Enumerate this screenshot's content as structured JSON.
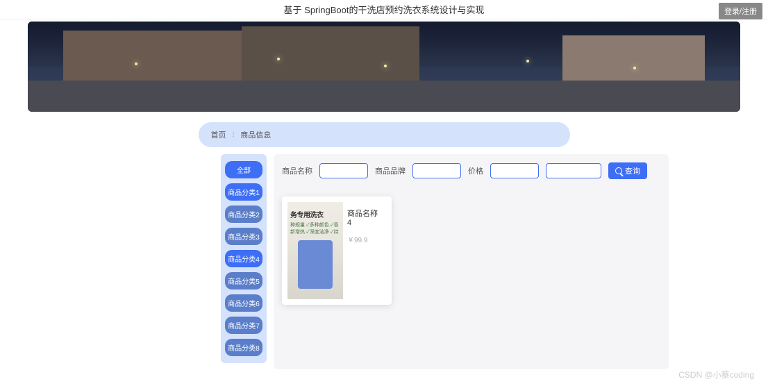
{
  "header": {
    "title": "基于 SpringBoot的干洗店预约洗衣系统设计与实现",
    "login_btn": "登录/注册"
  },
  "breadcrumb": {
    "home": "首页",
    "current": "商品信息"
  },
  "sidebar": {
    "categories": [
      {
        "label": "全部",
        "active": true
      },
      {
        "label": "商品分类1",
        "active": true
      },
      {
        "label": "商品分类2",
        "active": false
      },
      {
        "label": "商品分类3",
        "active": false
      },
      {
        "label": "商品分类4",
        "active": true
      },
      {
        "label": "商品分类5",
        "active": false
      },
      {
        "label": "商品分类6",
        "active": false
      },
      {
        "label": "商品分类7",
        "active": false
      },
      {
        "label": "商品分类8",
        "active": false
      }
    ]
  },
  "filters": {
    "name_label": "商品名称",
    "brand_label": "商品品牌",
    "price_label": "价格",
    "search_btn": "查询"
  },
  "products": [
    {
      "name": "商品名称4",
      "price": "￥99.9",
      "img_title": "务专用洗衣",
      "img_sub1": "种规量 ✓多种颜色 ✓香",
      "img_sub2": "新增热 ✓深度洁净 ✓持"
    }
  ],
  "watermark": "CSDN @小蔡coding"
}
